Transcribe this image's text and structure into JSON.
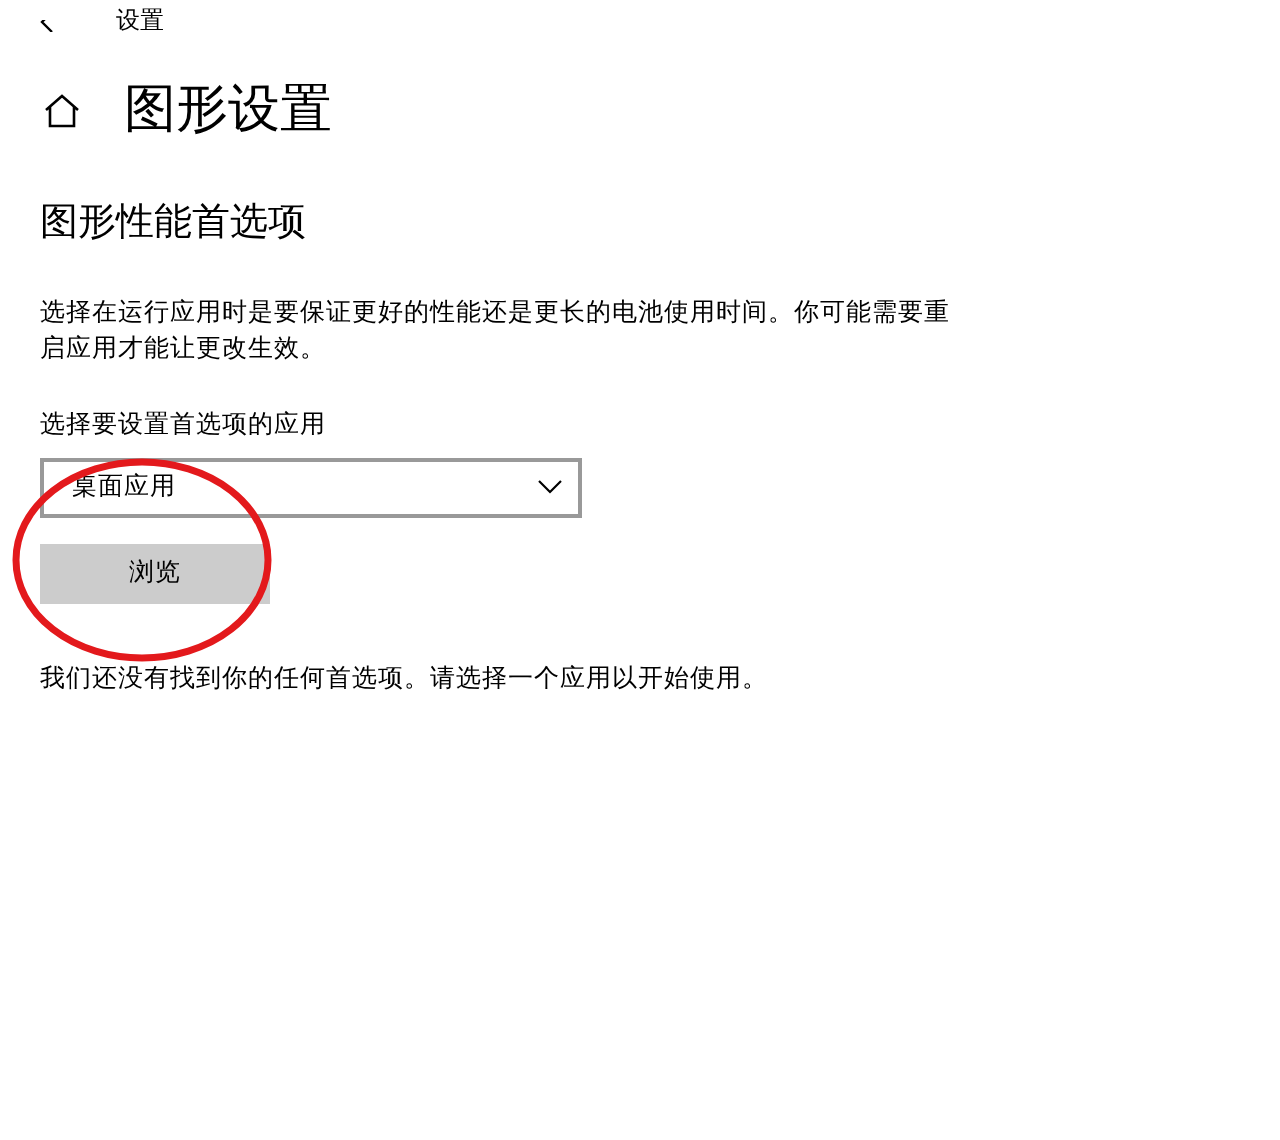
{
  "window": {
    "title": "设置"
  },
  "page": {
    "title": "图形设置"
  },
  "section": {
    "heading": "图形性能首选项",
    "description": "选择在运行应用时是要保证更好的性能还是更长的电池使用时间。你可能需要重启应用才能让更改生效。"
  },
  "app_picker": {
    "label": "选择要设置首选项的应用",
    "value": "桌面应用",
    "button": "浏览",
    "highlight_circle": true
  },
  "empty_message": "我们还没有找到你的任何首选项。请选择一个应用以开始使用。"
}
